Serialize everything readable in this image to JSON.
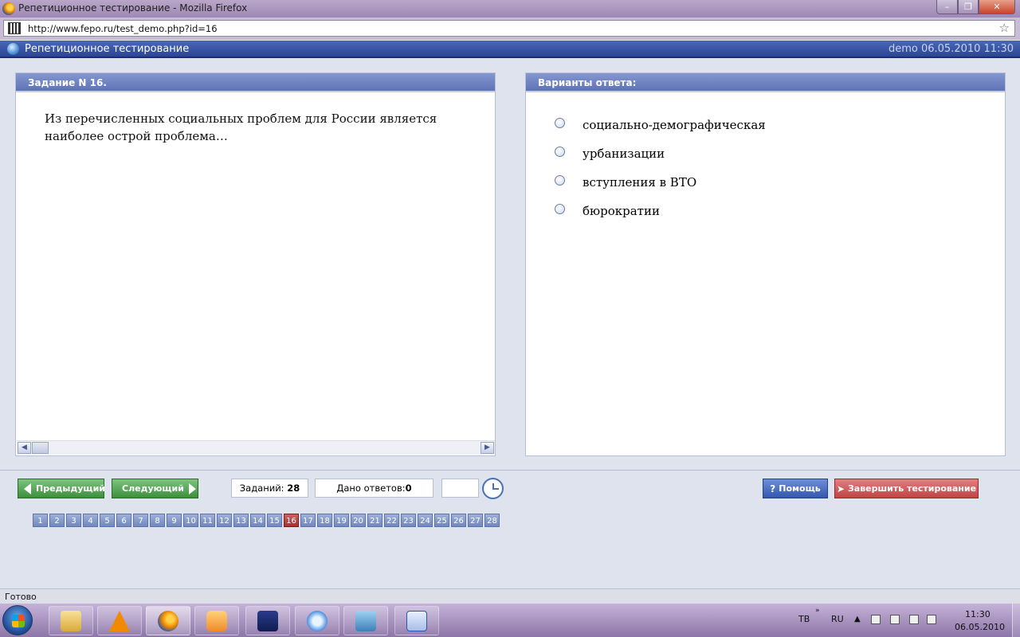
{
  "window": {
    "title": "Репетиционное тестирование - Mozilla Firefox"
  },
  "browser": {
    "url": "http://www.fepo.ru/test_demo.php?id=16",
    "status": "Готово"
  },
  "app": {
    "title": "Репетиционное тестирование",
    "status_text": "demo 06.05.2010 11:30"
  },
  "task": {
    "header": "Задание N 16.",
    "question": "Из перечисленных социальных проблем для России является наиболее острой проблема…"
  },
  "answers": {
    "header": "Варианты ответа:",
    "options": [
      "социально-демографическая",
      "урбанизации",
      "вступления в ВТО",
      "бюрократии"
    ]
  },
  "controls": {
    "prev_label": "Предыдущий",
    "next_label": "Следующий",
    "tasks_label": "Заданий:",
    "tasks_count": "28",
    "answered_label": "Дано ответов:",
    "answered_count": "0",
    "timer_value": "",
    "help_label": "Помощь",
    "finish_label": "Завершить тестирование"
  },
  "pager": {
    "current": 16,
    "pages": [
      "1",
      "2",
      "3",
      "4",
      "5",
      "6",
      "7",
      "8",
      "9",
      "10",
      "11",
      "12",
      "13",
      "14",
      "15",
      "16",
      "17",
      "18",
      "19",
      "20",
      "21",
      "22",
      "23",
      "24",
      "25",
      "26",
      "27",
      "28"
    ]
  },
  "taskbar": {
    "lang_primary": "ТВ",
    "lang_secondary": "RU",
    "time": "11:30",
    "date": "06.05.2010",
    "apps": [
      "windows-explorer-icon",
      "vlc-icon",
      "firefox-icon",
      "media-player-icon",
      "save-icon",
      "itunes-icon",
      "picture-viewer-icon",
      "word-icon"
    ]
  },
  "colors": {
    "header_blue": "#2c4694",
    "panel_header": "#5e73b6",
    "nav_green": "#3c8f3c",
    "help_blue": "#3557ae",
    "finish_red": "#c04444",
    "current_page": "#a83030"
  }
}
